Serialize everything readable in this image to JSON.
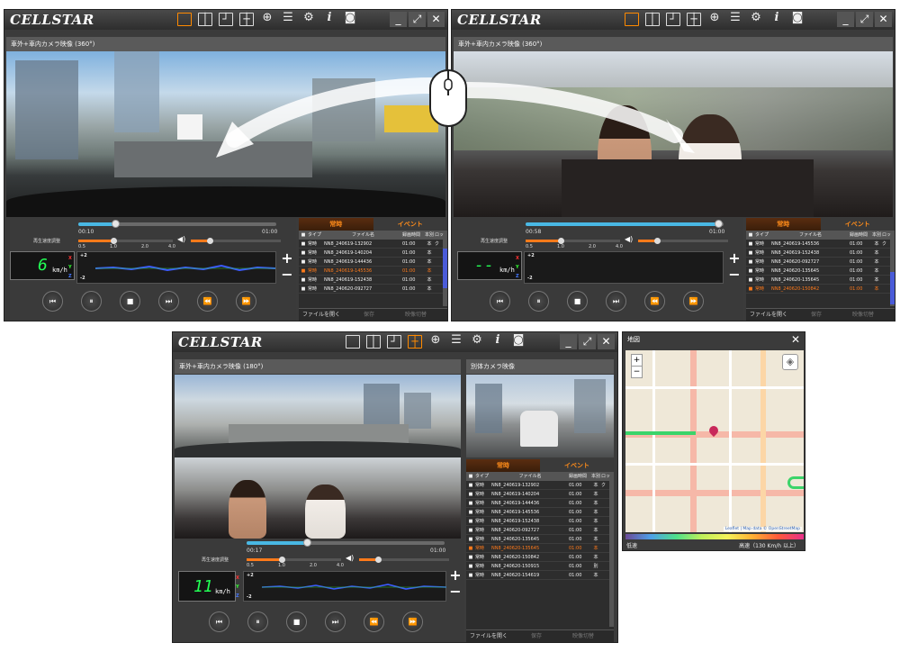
{
  "windows": [
    {
      "logo": "CELLSTAR",
      "caption": "車外+車内カメラ映像 (360°)",
      "time_current": "00:10",
      "time_total": "01:00",
      "speed_label": "再生速度調整",
      "speed_ticks": [
        "0.5",
        "1.0",
        "2.0",
        "4.0"
      ],
      "speed_value": "6",
      "speed_unit": "km/h",
      "progress": 0.18
    },
    {
      "logo": "CELLSTAR",
      "caption": "車外+車内カメラ映像 (360°)",
      "time_current": "00:58",
      "time_total": "01:00",
      "speed_label": "再生速度調整",
      "speed_ticks": [
        "0.5",
        "1.0",
        "2.0",
        "4.0"
      ],
      "speed_value": "--",
      "speed_unit": "km/h",
      "progress": 0.97
    },
    {
      "logo": "CELLSTAR",
      "caption": "車外+車内カメラ映像 (180°)",
      "caption2": "別体カメラ映像",
      "time_current": "00:17",
      "time_total": "01:00",
      "speed_label": "再生速度調整",
      "speed_ticks": [
        "0.5",
        "1.0",
        "2.0",
        "4.0"
      ],
      "speed_value": "11",
      "speed_unit": "km/h",
      "progress": 0.3
    }
  ],
  "tabs": {
    "normal": "常時",
    "event": "イベント"
  },
  "list_header": {
    "type": "タイプ",
    "file": "ファイル名",
    "duration": "録画時間",
    "count": "本別",
    "lock": "ロック"
  },
  "list1": [
    {
      "type": "常時",
      "file": "NN8_240619-132902",
      "dur": "01:00",
      "n": "本"
    },
    {
      "type": "常時",
      "file": "NN8_240619-140204",
      "dur": "01:00",
      "n": "本"
    },
    {
      "type": "常時",
      "file": "NN8_240619-144436",
      "dur": "01:00",
      "n": "本"
    },
    {
      "type": "常時",
      "file": "NN8_240619-145536",
      "dur": "01:00",
      "n": "本",
      "hl": true
    },
    {
      "type": "常時",
      "file": "NN8_240619-152438",
      "dur": "01:00",
      "n": "本"
    },
    {
      "type": "常時",
      "file": "NN8_240620-092727",
      "dur": "01:00",
      "n": "本"
    }
  ],
  "list2": [
    {
      "type": "常時",
      "file": "NN8_240619-145536",
      "dur": "01:00",
      "n": "本"
    },
    {
      "type": "常時",
      "file": "NN8_240619-152438",
      "dur": "01:00",
      "n": "本"
    },
    {
      "type": "常時",
      "file": "NN8_240620-092727",
      "dur": "01:00",
      "n": "本"
    },
    {
      "type": "常時",
      "file": "NN8_240620-135645",
      "dur": "01:00",
      "n": "本"
    },
    {
      "type": "常時",
      "file": "NN8_240620-135645",
      "dur": "01:00",
      "n": "本"
    },
    {
      "type": "常時",
      "file": "NN8_240620-150842",
      "dur": "01:00",
      "n": "本",
      "hl": true
    }
  ],
  "list3": [
    {
      "type": "常時",
      "file": "NN8_240619-132902",
      "dur": "01:00",
      "n": "本"
    },
    {
      "type": "常時",
      "file": "NN8_240619-140204",
      "dur": "01:00",
      "n": "本"
    },
    {
      "type": "常時",
      "file": "NN8_240619-144436",
      "dur": "01:00",
      "n": "本"
    },
    {
      "type": "常時",
      "file": "NN8_240619-145536",
      "dur": "01:00",
      "n": "本"
    },
    {
      "type": "常時",
      "file": "NN8_240619-152438",
      "dur": "01:00",
      "n": "本"
    },
    {
      "type": "常時",
      "file": "NN8_240620-092727",
      "dur": "01:00",
      "n": "本"
    },
    {
      "type": "常時",
      "file": "NN8_240620-135645",
      "dur": "01:00",
      "n": "本"
    },
    {
      "type": "常時",
      "file": "NN8_240620-135645",
      "dur": "01:00",
      "n": "本",
      "hl": true
    },
    {
      "type": "常時",
      "file": "NN8_240620-150842",
      "dur": "01:00",
      "n": "本"
    },
    {
      "type": "常時",
      "file": "NN8_240620-150915",
      "dur": "01:00",
      "n": "別"
    },
    {
      "type": "常時",
      "file": "NN8_240620-154619",
      "dur": "01:00",
      "n": "本"
    }
  ],
  "footer": {
    "open": "ファイルを開く",
    "save": "保存",
    "delete": "映像切替"
  },
  "gsensor": {
    "plus": "+2",
    "minus": "-2",
    "x": "X",
    "y": "Y",
    "z": "Z"
  },
  "map": {
    "title": "地図",
    "attribution": "Leaflet | Map data © OpenStreetMap",
    "legend_low": "低速",
    "legend_high": "高速（130 Km/h 以上）"
  },
  "colors": {
    "accent": "#ff8a00",
    "progress": "#49b8e4",
    "speed": "#22ff55"
  }
}
